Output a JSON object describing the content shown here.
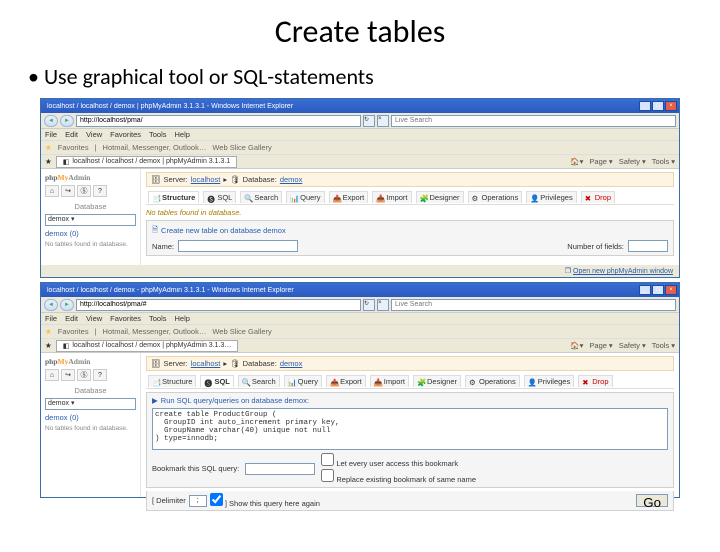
{
  "slide": {
    "title": "Create tables",
    "bullet": "Use graphical tool or SQL-statements"
  },
  "browser1": {
    "window_title": "localhost / localhost / demox | phpMyAdmin 3.1.3.1 - Windows Internet Explorer",
    "url": "http://localhost/pma/",
    "search_placeholder": "Live Search",
    "menu": [
      "File",
      "Edit",
      "View",
      "Favorites",
      "Tools",
      "Help"
    ],
    "favorites_label": "Favorites",
    "fav_links": [
      "Hotmail, Messenger, Outlook…",
      "Web Slice Gallery"
    ],
    "tab_label": "localhost / localhost / demox | phpMyAdmin 3.1.3.1",
    "toolbar": {
      "home": "Home",
      "page": "Page",
      "safety": "Safety",
      "tools": "Tools"
    }
  },
  "browser2": {
    "window_title": "localhost / localhost / demox - phpMyAdmin 3.1.3.1 - Windows Internet Explorer",
    "url": "http://localhost/pma/#",
    "search_placeholder": "Live Search",
    "menu": [
      "File",
      "Edit",
      "View",
      "Favorites",
      "Tools",
      "Help"
    ],
    "favorites_label": "Favorites",
    "fav_links": [
      "Hotmail, Messenger, Outlook…",
      "Web Slice Gallery"
    ],
    "tab_label": "localhost / localhost / demox | phpMyAdmin 3.1.3…",
    "toolbar": {
      "home": "Home",
      "page": "Page",
      "safety": "Safety",
      "tools": "Tools"
    }
  },
  "pma": {
    "sidebar": {
      "database_label": "Database",
      "db_selected": "demox",
      "db_link_1": "demox (0)",
      "db_link_2": "demox (0)",
      "no_tables": "No tables found in database."
    },
    "breadcrumb": {
      "server_label": "Server:",
      "server": "localhost",
      "db_label": "Database:",
      "db": "demox"
    },
    "tabs": {
      "structure": "Structure",
      "sql": "SQL",
      "search": "Search",
      "query": "Query",
      "export": "Export",
      "import": "Import",
      "designer": "Designer",
      "operations": "Operations",
      "privileges": "Privileges",
      "drop": "Drop"
    },
    "structure_page": {
      "no_tables": "No tables found in database.",
      "create_title": "Create new table on database demox",
      "name_label": "Name:",
      "fields_label": "Number of fields:"
    },
    "sql_page": {
      "run_title": "Run SQL query/queries on database demox:",
      "sql_text": "create table ProductGroup (\n  GroupID int auto_increment primary key,\n  GroupName varchar(40) unique not null\n) type=innodb;",
      "bookmark_label": "Bookmark this SQL query:",
      "cb_let_users": "Let every user access this bookmark",
      "cb_replace": "Replace existing bookmark of same name",
      "delimiter_label": "[ Delimiter",
      "delimiter_value": ";",
      "show_again": "] Show this query here again",
      "go": "Go"
    },
    "footer_link": "Open new phpMyAdmin window"
  }
}
